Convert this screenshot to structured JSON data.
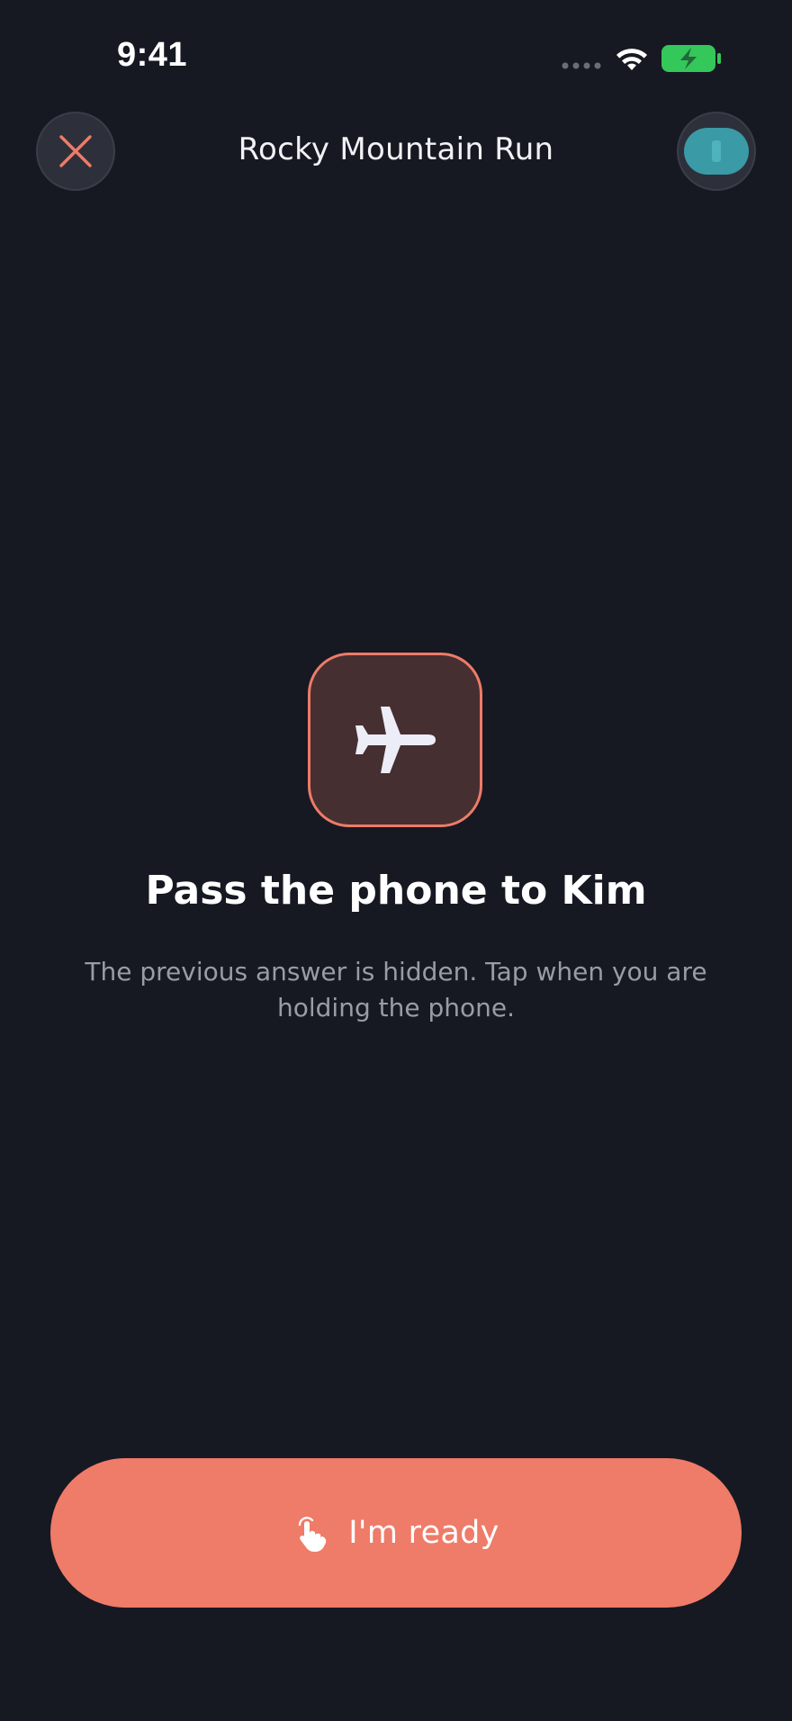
{
  "status_bar": {
    "time": "9:41",
    "battery_color": "#34c759"
  },
  "header": {
    "title": "Rocky Mountain Run",
    "close_icon": "close-icon",
    "avatar_color": "#3a9aa6"
  },
  "handoff": {
    "icon": "airplane-icon",
    "title": "Pass the phone to Kim",
    "subtitle": "The previous answer is hidden. Tap when you are holding the phone."
  },
  "ready_button": {
    "label": "I'm ready",
    "icon": "tap-hand-icon",
    "color": "#ef7b69"
  },
  "colors": {
    "background": "#161922",
    "accent": "#ef7b69",
    "tile_fill": "#462f31"
  }
}
